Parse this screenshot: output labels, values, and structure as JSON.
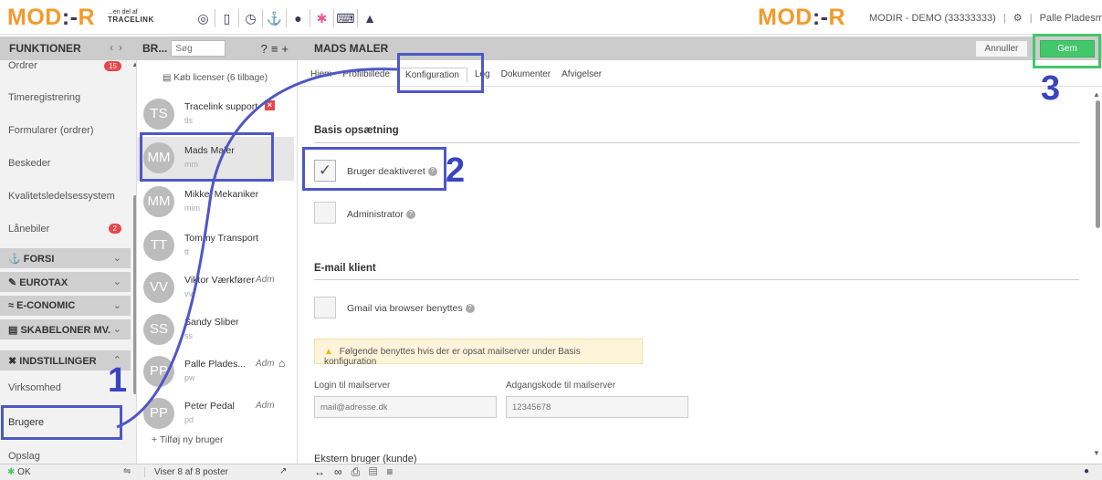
{
  "app": {
    "logo_text_left": "MOD",
    "logo_text_dots": ":-",
    "logo_text_right": "R",
    "sublogo_top": "...en del af",
    "sublogo_brand": "TRACELINK",
    "account_text": "MODIR - DEMO (33333333)",
    "user_name": "Palle Pladesmed"
  },
  "header": {
    "functions_title": "FUNKTIONER",
    "list_title": "BR...",
    "search_placeholder": "Søg",
    "main_title": "MADS MALER",
    "annuller_label": "Annuller",
    "gem_label": "Gem"
  },
  "sidebar": {
    "items": [
      {
        "label": "Ordrer",
        "badge": "15"
      },
      {
        "label": "Timeregistrering"
      },
      {
        "label": "Formularer (ordrer)"
      },
      {
        "label": "Beskeder"
      },
      {
        "label": "Kvalitetsledelsessystem"
      },
      {
        "label": "Lånebiler",
        "badge": "2"
      }
    ],
    "sections": [
      {
        "label": "FORSI"
      },
      {
        "label": "EUROTAX"
      },
      {
        "label": "E-CONOMIC"
      },
      {
        "label": "SKABELONER MV."
      },
      {
        "label": "INDSTILLINGER"
      }
    ],
    "sub_items": [
      {
        "label": "Virksomhed"
      },
      {
        "label": "Brugere"
      },
      {
        "label": "Opslag"
      }
    ]
  },
  "userlist": {
    "buy_label": "Køb licenser (6 tilbage)",
    "users": [
      {
        "initials": "TS",
        "name": "Tracelink support",
        "sub": "tls",
        "role": ""
      },
      {
        "initials": "MM",
        "name": "Mads Maler",
        "sub": "mm",
        "role": ""
      },
      {
        "initials": "MM",
        "name": "Mikkel Mekaniker",
        "sub": "mim",
        "role": ""
      },
      {
        "initials": "TT",
        "name": "Tommy Transport",
        "sub": "tt",
        "role": ""
      },
      {
        "initials": "VV",
        "name": "Viktor Værkfører",
        "sub": "vv",
        "role": "Adm"
      },
      {
        "initials": "SS",
        "name": "Sandy Sliber",
        "sub": "ss",
        "role": ""
      },
      {
        "initials": "PP",
        "name": "Palle Plades...",
        "sub": "pw",
        "role": "Adm"
      },
      {
        "initials": "PP",
        "name": "Peter Pedal",
        "sub": "pd",
        "role": "Adm"
      }
    ],
    "add_user_label": "+ Tilføj ny bruger"
  },
  "main": {
    "tabs": [
      {
        "label": "Hjem"
      },
      {
        "label": "Profilbillede"
      },
      {
        "label": "Konfiguration"
      },
      {
        "label": "Log"
      },
      {
        "label": "Dokumenter"
      },
      {
        "label": "Afvigelser"
      }
    ],
    "basis_title": "Basis opsætning",
    "deactivated_label": "Bruger deaktiveret",
    "admin_label": "Administrator",
    "email_title": "E-mail klient",
    "gmail_label": "Gmail via browser benyttes",
    "warning_text": "Følgende benyttes hvis der er opsat mailserver under Basis konfiguration",
    "login_label": "Login til mailserver",
    "login_placeholder": "mail@adresse.dk",
    "password_label": "Adgangskode til mailserver",
    "password_placeholder": "12345678",
    "external_title": "Ekstern bruger (kunde)"
  },
  "status": {
    "ok_label": "OK",
    "count_label": "Viser 8 af 8 poster"
  },
  "annotations": {
    "step1": "1",
    "step2": "2",
    "step3": "3"
  },
  "colors": {
    "brand_orange": "#f39a2a",
    "highlight_blue": "#3944c0",
    "save_green": "#43c76b",
    "badge_red": "#e8464b"
  }
}
